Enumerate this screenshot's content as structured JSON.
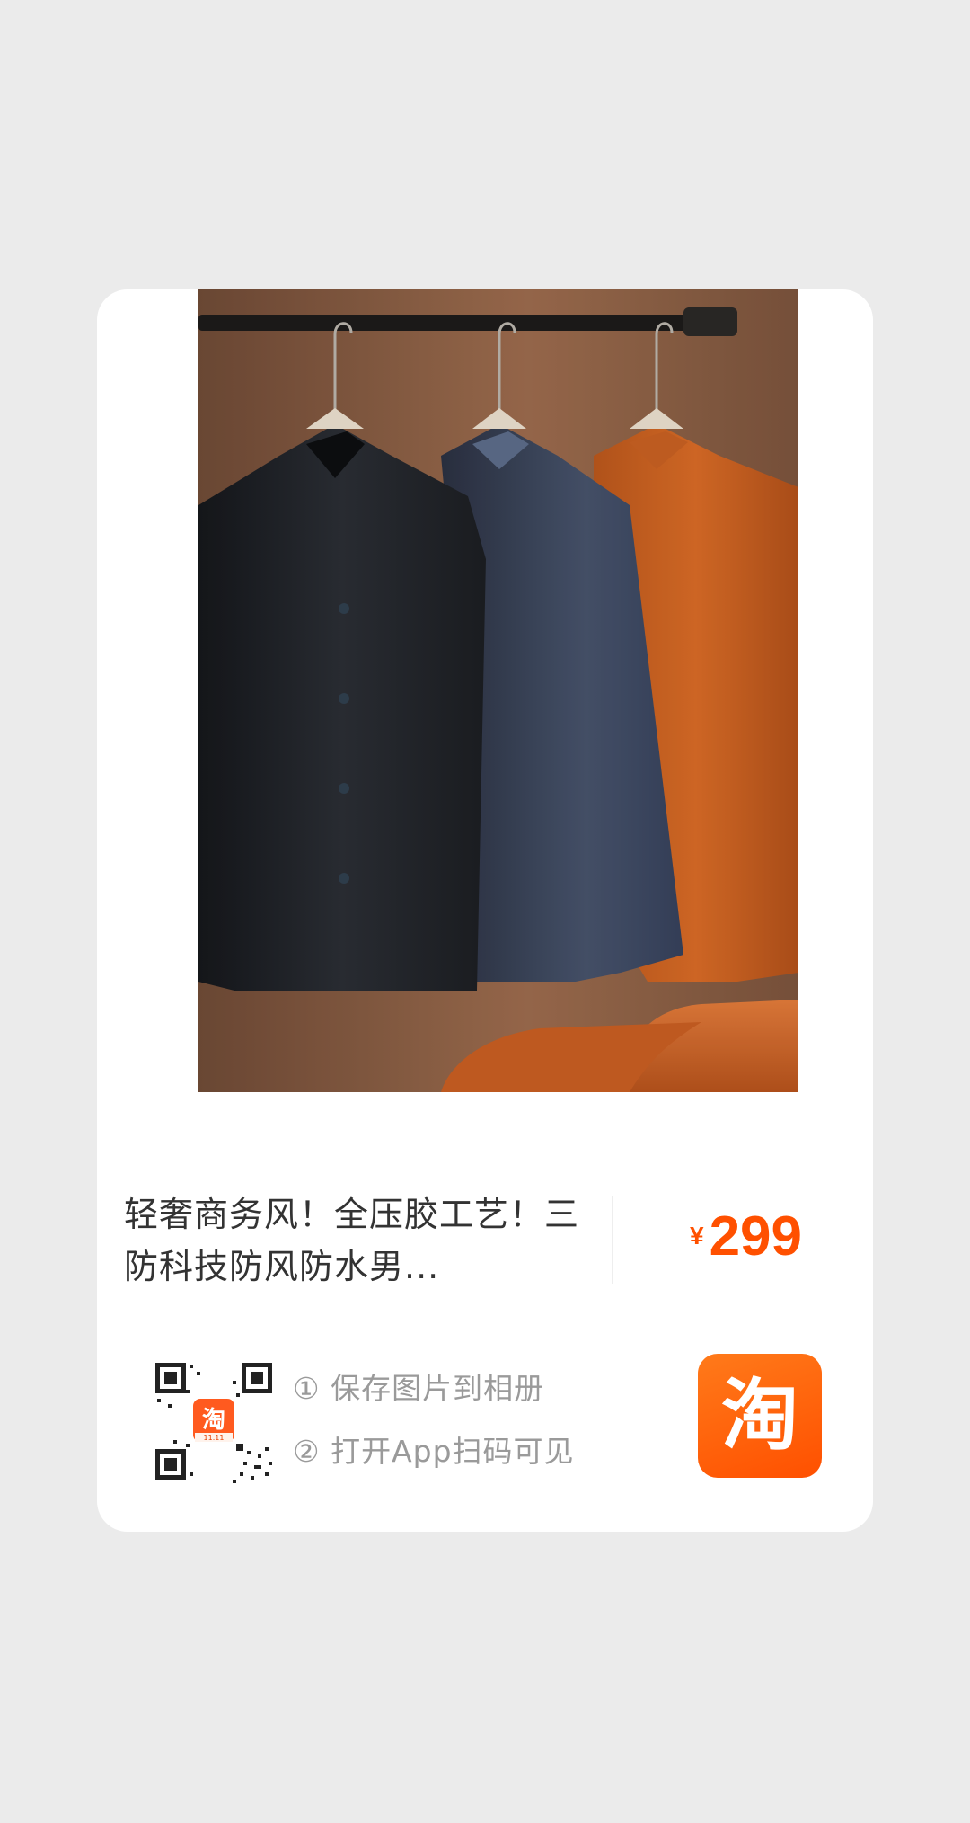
{
  "product": {
    "title": "轻奢商务风！全压胶工艺！三防科技防风防水男...",
    "price_symbol": "¥",
    "price": "299"
  },
  "instructions": {
    "step1": "① 保存图片到相册",
    "step2": "② 打开App扫码可见"
  },
  "qr": {
    "badge_text": "淘",
    "badge_sub": "11.11"
  },
  "app": {
    "name": "淘",
    "brand_color": "#ff5000"
  },
  "image": {
    "subject": "three shirts on hangers"
  }
}
